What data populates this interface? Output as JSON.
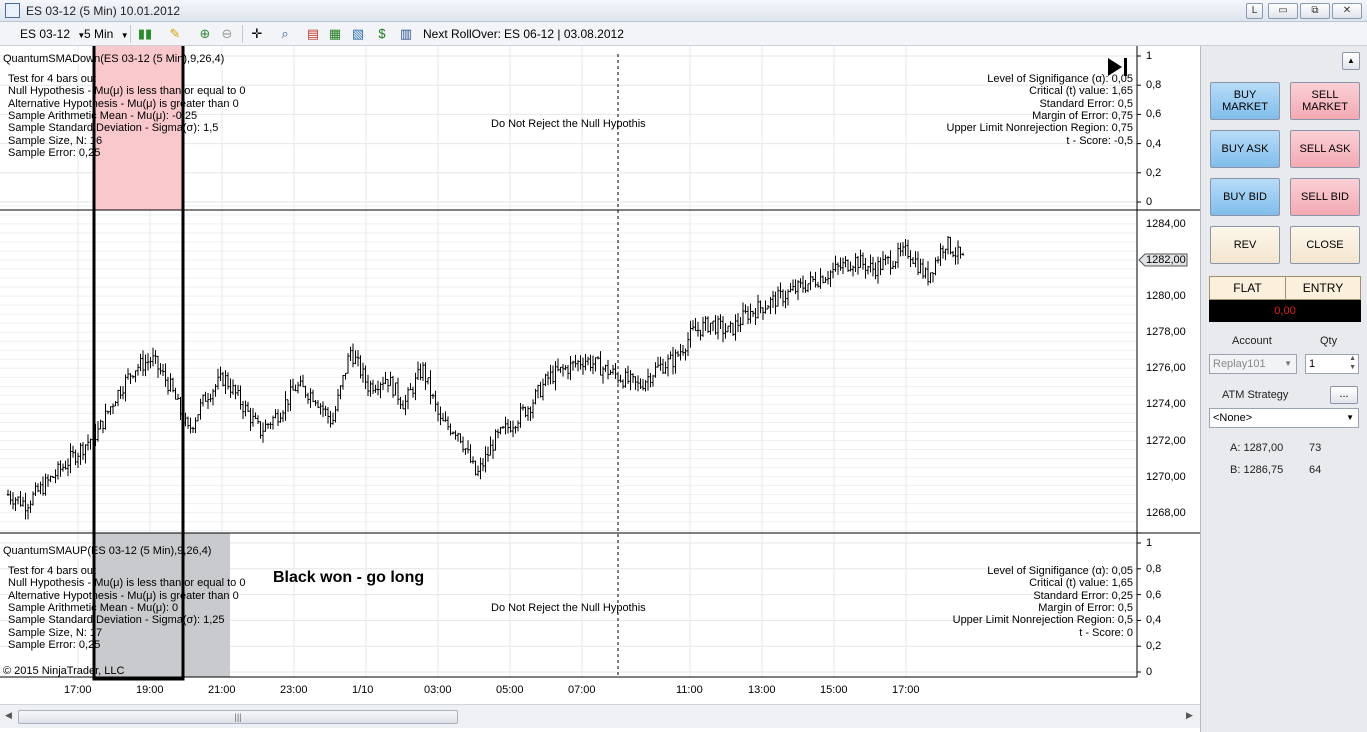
{
  "window": {
    "title": "ES 03-12 (5 Min)  10.01.2012",
    "help_label": "L",
    "minimize_label": "▭",
    "restore_label": "⧉",
    "close_label": "✕"
  },
  "toolbar": {
    "instrument": "ES 03-12",
    "interval": "5 Min",
    "rollover_label": "Next RollOver:",
    "rollover_value": "ES 06-12 | 03.08.2012"
  },
  "top_panel": {
    "indicator_label": "QuantumSMADown(ES 03-12 (5 Min),9,26,4)",
    "stats_left": [
      "Test for 4 bars out",
      "Null Hypothesis - Mu(μ) is less than or equal to 0",
      "Alternative Hypothesis - Mu(μ) is greater than 0",
      "Sample Arithmetic Mean - Mu(μ): -0,25",
      "Sample Standard Deviation - Sigma(σ): 1,5",
      "Sample Size, N: 16",
      "Sample Error: 0,25"
    ],
    "center_text": "Do Not Reject the Null Hypothis",
    "stats_right": [
      "Level of Signifigance (α): 0,05",
      "Critical (t) value: 1,65",
      "Standard Error: 0,5",
      "Margin of Error: 0,75",
      "Upper Limit Nonrejection Region: 0,75",
      "t - Score: -0,5"
    ],
    "y_ticks": [
      "1",
      "0,8",
      "0,6",
      "0,4",
      "0,2",
      "0"
    ]
  },
  "price_panel": {
    "y_ticks": [
      "1284,00",
      "1282,00",
      "1280,00",
      "1278,00",
      "1276,00",
      "1274,00",
      "1272,00",
      "1270,00",
      "1268,00"
    ],
    "last_price": "1282,00"
  },
  "bottom_panel": {
    "indicator_label": "QuantumSMAUP(ES 03-12 (5 Min),9,26,4)",
    "annotation": "Black won - go long",
    "stats_left": [
      "Test for 4 bars out",
      "Null Hypothesis - Mu(μ) is less than or equal to 0",
      "Alternative Hypothesis - Mu(μ) is greater than 0",
      "Sample Arithmetic Mean - Mu(μ): 0",
      "Sample Standard Deviation - Sigma(σ): 1,25",
      "Sample Size, N: 17",
      "Sample Error: 0,25"
    ],
    "center_text": "Do Not Reject the Null Hypothis",
    "stats_right": [
      "Level of Signifigance (α): 0,05",
      "Critical (t) value: 1,65",
      "Standard Error: 0,25",
      "Margin of Error: 0,5",
      "Upper Limit Nonrejection Region: 0,5",
      "t - Score: 0"
    ],
    "y_ticks": [
      "1",
      "0,8",
      "0,6",
      "0,4",
      "0,2",
      "0"
    ],
    "copyright": "© 2015 NinjaTrader, LLC"
  },
  "x_axis": {
    "ticks": [
      "17:00",
      "19:00",
      "21:00",
      "23:00",
      "1/10",
      "03:00",
      "05:00",
      "07:00",
      "11:00",
      "13:00",
      "15:00",
      "17:00"
    ]
  },
  "colors": {
    "highlight_red": "#f8c8cc",
    "highlight_gray": "#c8cacd",
    "bar": "#000000",
    "grid": "#e4e6ea"
  },
  "chart_data": {
    "type": "ohlc",
    "price_range": [
      1267,
      1285
    ],
    "close_approx": [
      1269,
      1268.5,
      1269.5,
      1270.5,
      1271.5,
      1272.5,
      1274.5,
      1276,
      1276.5,
      1275,
      1272.5,
      1274.5,
      1275.5,
      1274,
      1272.5,
      1273.5,
      1275,
      1274.5,
      1273,
      1277,
      1275,
      1275.5,
      1274,
      1276,
      1273,
      1272.5,
      1270,
      1272,
      1273,
      1274,
      1275.5,
      1276,
      1276.5,
      1276,
      1275.5,
      1275,
      1276,
      1276.5,
      1278,
      1278.5,
      1278,
      1279,
      1279.5,
      1280,
      1280.5,
      1281,
      1281.5,
      1282,
      1281.5,
      1282,
      1282.5,
      1281,
      1283,
      1282
    ]
  },
  "side_panel": {
    "buy_market": "BUY MARKET",
    "sell_market": "SELL MARKET",
    "buy_ask": "BUY ASK",
    "sell_ask": "SELL ASK",
    "buy_bid": "BUY BID",
    "sell_bid": "SELL BID",
    "rev": "REV",
    "close": "CLOSE",
    "position": "FLAT",
    "entry": "ENTRY",
    "pnl": "0,00",
    "account_label": "Account",
    "qty_label": "Qty",
    "account_value": "Replay101",
    "qty_value": "1",
    "atm_label": "ATM Strategy",
    "atm_button": "...",
    "atm_value": "<None>",
    "ask_label": "A: 1287,00",
    "ask_size": "73",
    "bid_label": "B: 1286,75",
    "bid_size": "64"
  }
}
